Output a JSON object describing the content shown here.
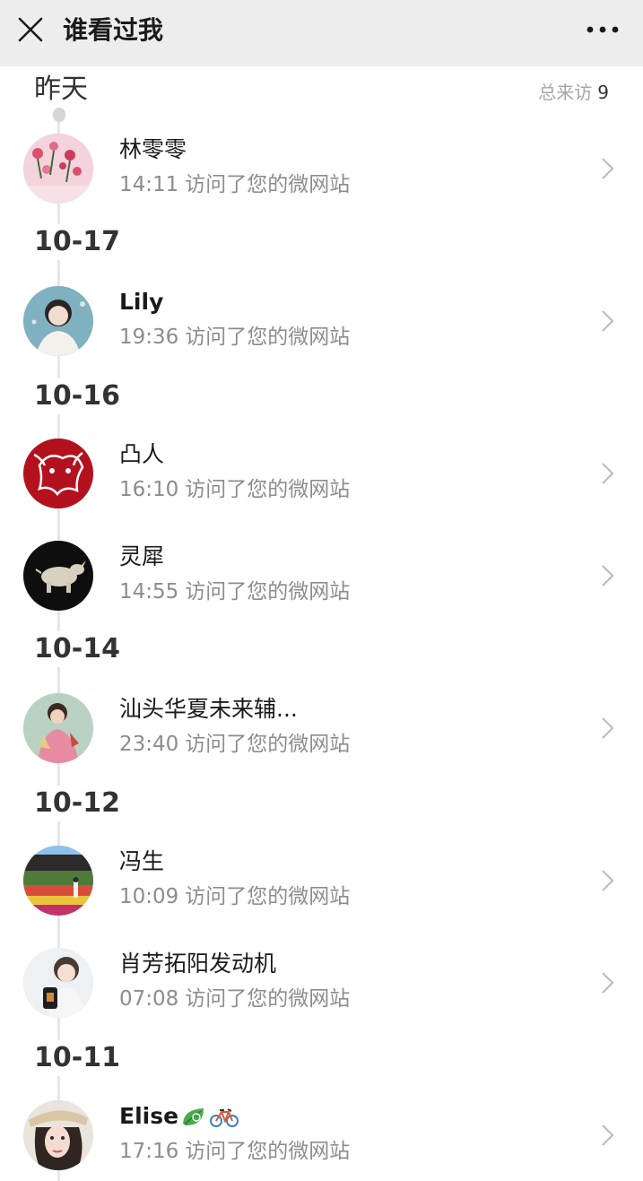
{
  "header": {
    "title": "谁看过我",
    "close_icon": "close-icon",
    "more_icon": "more-dots-icon"
  },
  "total_visits": {
    "label": "总来访",
    "count": "9"
  },
  "groups": [
    {
      "date": "昨天",
      "visitors": [
        {
          "name": "林零零",
          "time": "14:11",
          "action": "访问了您的微网站",
          "avatar": "pink-flowers-avatar"
        }
      ]
    },
    {
      "date": "10-17",
      "visitors": [
        {
          "name": "Lily",
          "time": "19:36",
          "action": "访问了您的微网站",
          "avatar": "woman-portrait-avatar"
        }
      ]
    },
    {
      "date": "10-16",
      "visitors": [
        {
          "name": "凸人",
          "time": "16:10",
          "action": "访问了您的微网站",
          "avatar": "red-papercut-ox-avatar"
        },
        {
          "name": "灵犀",
          "time": "14:55",
          "action": "访问了您的微网站",
          "avatar": "rhino-figurine-avatar"
        }
      ]
    },
    {
      "date": "10-14",
      "visitors": [
        {
          "name": "汕头华夏未来辅...",
          "time": "23:40",
          "action": "访问了您的微网站",
          "avatar": "painted-woman-avatar"
        }
      ]
    },
    {
      "date": "10-12",
      "visitors": [
        {
          "name": "冯生",
          "time": "10:09",
          "action": "访问了您的微网站",
          "avatar": "flower-garden-avatar"
        },
        {
          "name": "肖芳拓阳发动机",
          "time": "07:08",
          "action": "访问了您的微网站",
          "avatar": "woman-selfie-avatar"
        }
      ]
    },
    {
      "date": "10-11",
      "visitors": [
        {
          "name": "Elise",
          "time": "17:16",
          "action": "访问了您的微网站",
          "avatar": "woman-hat-avatar",
          "emojis": [
            "leaf-emoji-icon",
            "bicycle-emoji-icon"
          ]
        }
      ]
    }
  ],
  "colors": {
    "header_bg": "#ededed",
    "timeline": "#e6e6e6",
    "secondary_text": "#8c8c8c"
  }
}
